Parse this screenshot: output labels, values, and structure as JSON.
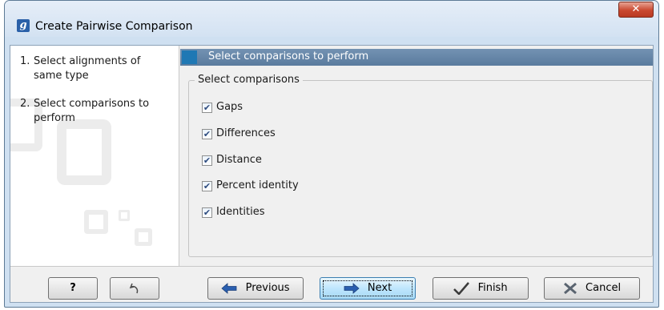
{
  "window": {
    "title": "Create Pairwise Comparison",
    "app_icon_letter": "g",
    "close_glyph": "✕"
  },
  "steps": [
    {
      "number": "1.",
      "text": "Select alignments of same type"
    },
    {
      "number": "2.",
      "text": "Select comparisons to perform"
    }
  ],
  "section": {
    "title": "Select comparisons to perform"
  },
  "group": {
    "legend": "Select comparisons",
    "options": [
      {
        "label": "Gaps",
        "checked": true
      },
      {
        "label": "Differences",
        "checked": true
      },
      {
        "label": "Distance",
        "checked": true
      },
      {
        "label": "Percent identity",
        "checked": true
      },
      {
        "label": "Identities",
        "checked": true
      }
    ]
  },
  "footer": {
    "help_label": "?",
    "reset_icon": "undo-arrow-icon",
    "previous_label": "Previous",
    "next_label": "Next",
    "finish_label": "Finish",
    "cancel_label": "Cancel"
  },
  "colors": {
    "section_header": "#5a7b9e",
    "accent_square": "#1f78b4",
    "arrow_blue": "#2a5fb0",
    "cancel_x": "#5a6470"
  }
}
